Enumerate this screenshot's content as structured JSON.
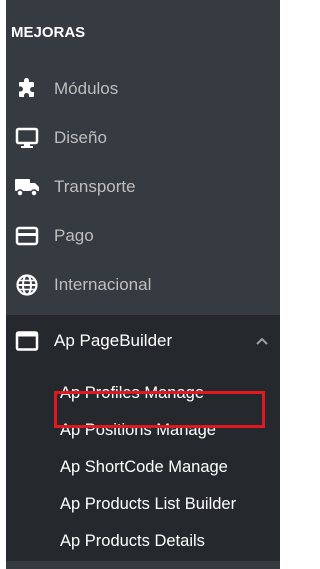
{
  "sidebar": {
    "section_title": "MEJORAS",
    "items": [
      {
        "label": "Módulos",
        "icon": "puzzle-icon"
      },
      {
        "label": "Diseño",
        "icon": "monitor-icon"
      },
      {
        "label": "Transporte",
        "icon": "truck-icon"
      },
      {
        "label": "Pago",
        "icon": "credit-card-icon"
      },
      {
        "label": "Internacional",
        "icon": "globe-icon"
      }
    ],
    "active_item": {
      "label": "Ap PageBuilder",
      "icon": "window-icon",
      "expanded": true
    },
    "submenu": [
      {
        "label": "Ap Profiles Manage",
        "highlighted": true
      },
      {
        "label": "Ap Positions Manage"
      },
      {
        "label": "Ap ShortCode Manage"
      },
      {
        "label": "Ap Products List Builder"
      },
      {
        "label": "Ap Products Details"
      }
    ]
  },
  "colors": {
    "sidebar_bg": "#363a41",
    "active_bg": "#25292e",
    "text_muted": "#bebebe",
    "text_white": "#ffffff",
    "highlight_border": "#e0181f"
  }
}
